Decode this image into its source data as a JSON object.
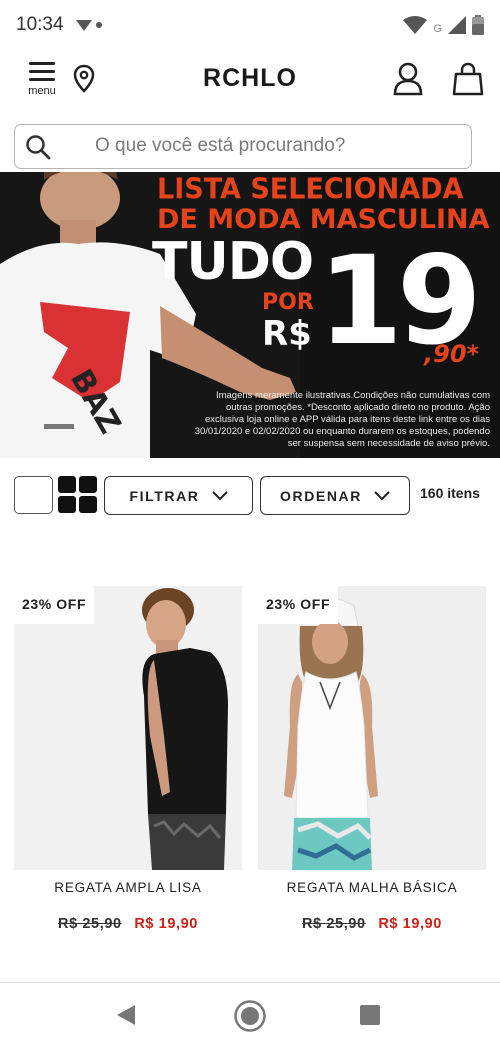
{
  "status_bar": {
    "time": "10:34",
    "network_label": "G"
  },
  "header": {
    "menu_label": "menu",
    "logo": "RCHLO"
  },
  "search": {
    "placeholder": "O que você está procurando?"
  },
  "banner": {
    "headline_line1": "LISTA SELECIONADA",
    "headline_line2": "DE MODA MASCULINA",
    "tudo": "TUDO",
    "por": "POR",
    "currency": "R$",
    "price_int": "19",
    "price_dec": ",90*",
    "disclaimer": "Imagens meramente ilustrativas.Condições não cumulativas com outras promoções. *Desconto aplicado direto no produto. Ação exclusiva loja online e APP válida para itens deste link entre os dias 30/01/2020 e 02/02/2020 ou enquanto durarem os estoques, podendo ser suspensa sem necessidade de aviso prévio.",
    "accent_color": "#e4431c"
  },
  "toolbar": {
    "filter_label": "FILTRAR",
    "sort_label": "ORDENAR",
    "items_count": "160 itens"
  },
  "products": [
    {
      "badge": "23% OFF",
      "name": "REGATA AMPLA LISA",
      "old_price": "R$ 25,90",
      "new_price": "R$ 19,90"
    },
    {
      "badge": "23% OFF",
      "name": "REGATA MALHA BÁSICA",
      "old_price": "R$ 25,90",
      "new_price": "R$ 19,90"
    }
  ],
  "colors": {
    "sale_price": "#d0201a",
    "text": "#222222"
  },
  "icons": [
    "hamburger-icon",
    "location-pin-icon",
    "user-icon",
    "shopping-bag-icon",
    "search-icon",
    "chevron-down-icon",
    "nav-back-icon",
    "nav-home-icon",
    "nav-recent-icon"
  ]
}
